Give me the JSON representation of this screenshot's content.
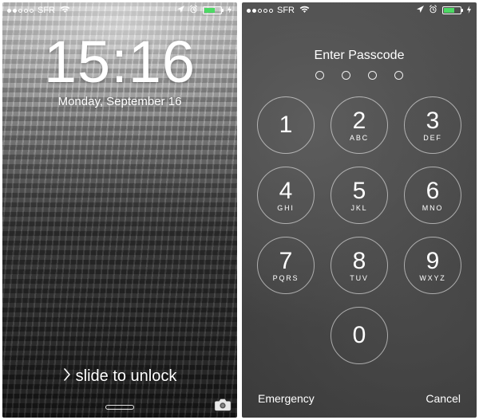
{
  "status": {
    "signal_filled": 2,
    "signal_total": 5,
    "carrier": "SFR",
    "battery_pct": 60,
    "battery_color": "#4cd964"
  },
  "lock": {
    "time": "15:16",
    "date": "Monday, September 16",
    "unlock_text": "slide to unlock"
  },
  "passcode": {
    "title": "Enter Passcode",
    "dots": 4,
    "keys": [
      {
        "d": "1",
        "l": ""
      },
      {
        "d": "2",
        "l": "ABC"
      },
      {
        "d": "3",
        "l": "DEF"
      },
      {
        "d": "4",
        "l": "GHI"
      },
      {
        "d": "5",
        "l": "JKL"
      },
      {
        "d": "6",
        "l": "MNO"
      },
      {
        "d": "7",
        "l": "PQRS"
      },
      {
        "d": "8",
        "l": "TUV"
      },
      {
        "d": "9",
        "l": "WXYZ"
      },
      {
        "d": "0",
        "l": ""
      }
    ],
    "emergency": "Emergency",
    "cancel": "Cancel"
  }
}
